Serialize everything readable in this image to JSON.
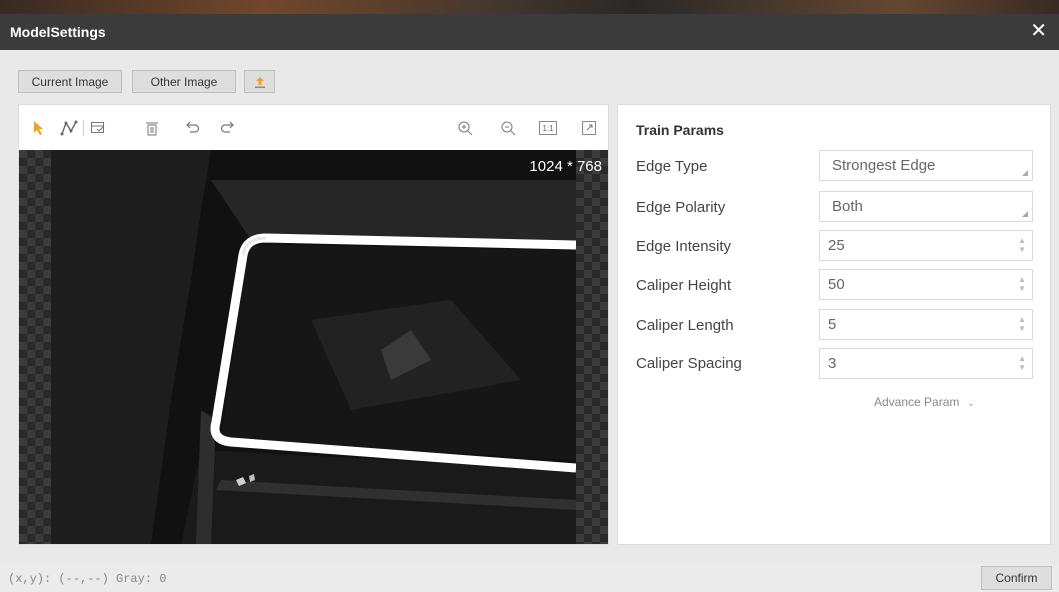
{
  "dialog": {
    "title": "ModelSettings",
    "close_glyph": "✕"
  },
  "source_tabs": {
    "current": "Current Image",
    "other": "Other Image",
    "upload_icon": "upload-icon"
  },
  "toolbar": {
    "icons": [
      "pointer-icon",
      "polyline-icon",
      "select-region-icon",
      "delete-icon",
      "undo-icon",
      "redo-icon",
      "zoom-in-icon",
      "zoom-out-icon",
      "actual-size-icon",
      "fit-window-icon"
    ],
    "actual_size_label": "1:1"
  },
  "image": {
    "dimensions": "1024 * 768"
  },
  "train_params": {
    "title": "Train Params",
    "edge_type": {
      "label": "Edge Type",
      "value": "Strongest Edge"
    },
    "edge_polarity": {
      "label": "Edge Polarity",
      "value": "Both"
    },
    "edge_intensity": {
      "label": "Edge Intensity",
      "value": "25"
    },
    "caliper_height": {
      "label": "Caliper Height",
      "value": "50"
    },
    "caliper_length": {
      "label": "Caliper Length",
      "value": "5"
    },
    "caliper_spacing": {
      "label": "Caliper Spacing",
      "value": "3"
    },
    "advance": "Advance Param"
  },
  "status": {
    "coords": "(x,y): (--,--) Gray: 0"
  },
  "footer": {
    "confirm": "Confirm"
  }
}
